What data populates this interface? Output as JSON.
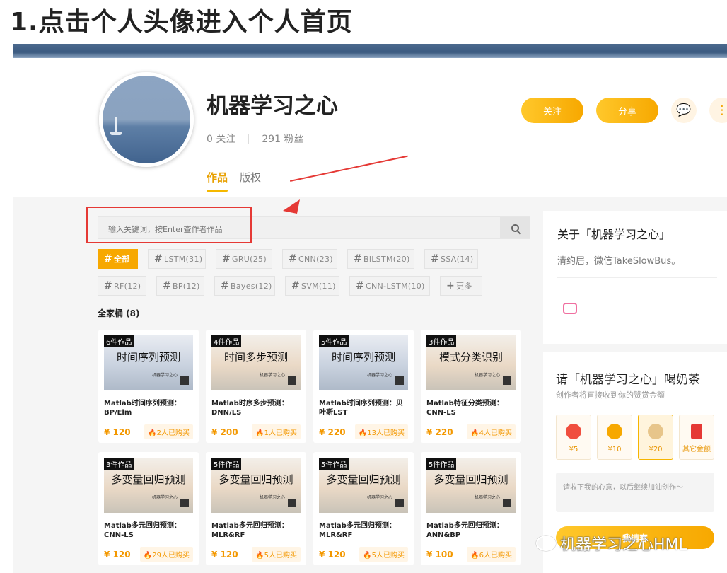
{
  "heading": "1.点击个人头像进入个人首页",
  "profile": {
    "name": "机器学习之心",
    "following": "0 关注",
    "fans": "291 粉丝",
    "tabs": [
      "作品",
      "版权"
    ],
    "follow_label": "关注",
    "share_label": "分享"
  },
  "search": {
    "placeholder": "输入关键词，按Enter查作者作品"
  },
  "tags": [
    "全部",
    "LSTM(31)",
    "GRU(25)",
    "CNN(23)",
    "BiLSTM(20)",
    "SSA(14)",
    "RF(12)",
    "BP(12)",
    "Bayes(12)",
    "SVM(11)",
    "CNN-LSTM(10)",
    "更多"
  ],
  "family_title": "全家桶 (8)",
  "cards": [
    {
      "count": "6件作品",
      "thumb_title": "时间序列预测",
      "name": "Matlab时间序列预测：BP/Elm",
      "price": "¥ 120",
      "bought": "2人已购买"
    },
    {
      "count": "4件作品",
      "thumb_title": "时间多步预测",
      "name": "Matlab时序多步预测：DNN/LS",
      "price": "¥ 200",
      "bought": "1人已购买"
    },
    {
      "count": "5件作品",
      "thumb_title": "时间序列预测",
      "name": "Matlab时间序列预测：贝叶斯LST",
      "price": "¥ 220",
      "bought": "13人已购买"
    },
    {
      "count": "3件作品",
      "thumb_title": "模式分类识别",
      "name": "Matlab特征分类预测：CNN-LS",
      "price": "¥ 220",
      "bought": "4人已购买"
    },
    {
      "count": "3件作品",
      "thumb_title": "多变量回归预测",
      "name": "Matlab多元回归预测：CNN-LS",
      "price": "¥ 120",
      "bought": "29人已购买"
    },
    {
      "count": "5件作品",
      "thumb_title": "多变量回归预测",
      "name": "Matlab多元回归预测：MLR&RF",
      "price": "¥ 120",
      "bought": "5人已购买"
    },
    {
      "count": "5件作品",
      "thumb_title": "多变量回归预测",
      "name": "Matlab多元回归预测：MLR&RF",
      "price": "¥ 120",
      "bought": "5人已购买"
    },
    {
      "count": "5件作品",
      "thumb_title": "多变量回归预测",
      "name": "Matlab多元回归预测：ANN&BP",
      "price": "¥ 100",
      "bought": "6人已购买"
    }
  ],
  "thumb_brand": "机器学习之心",
  "about": {
    "title": "关于「机器学习之心」",
    "desc": "清约居，微信TakeSlowBus。"
  },
  "tip": {
    "title": "请「机器学习之心」喝奶茶",
    "sub": "创作者将直接收到你的赞赏金额",
    "options": [
      "¥5",
      "¥10",
      "¥20",
      "其它金额"
    ],
    "message_placeholder": "请收下我的心意，以后继续加油创作～",
    "button": "我请客"
  },
  "watermark": "机器学习之心HML"
}
